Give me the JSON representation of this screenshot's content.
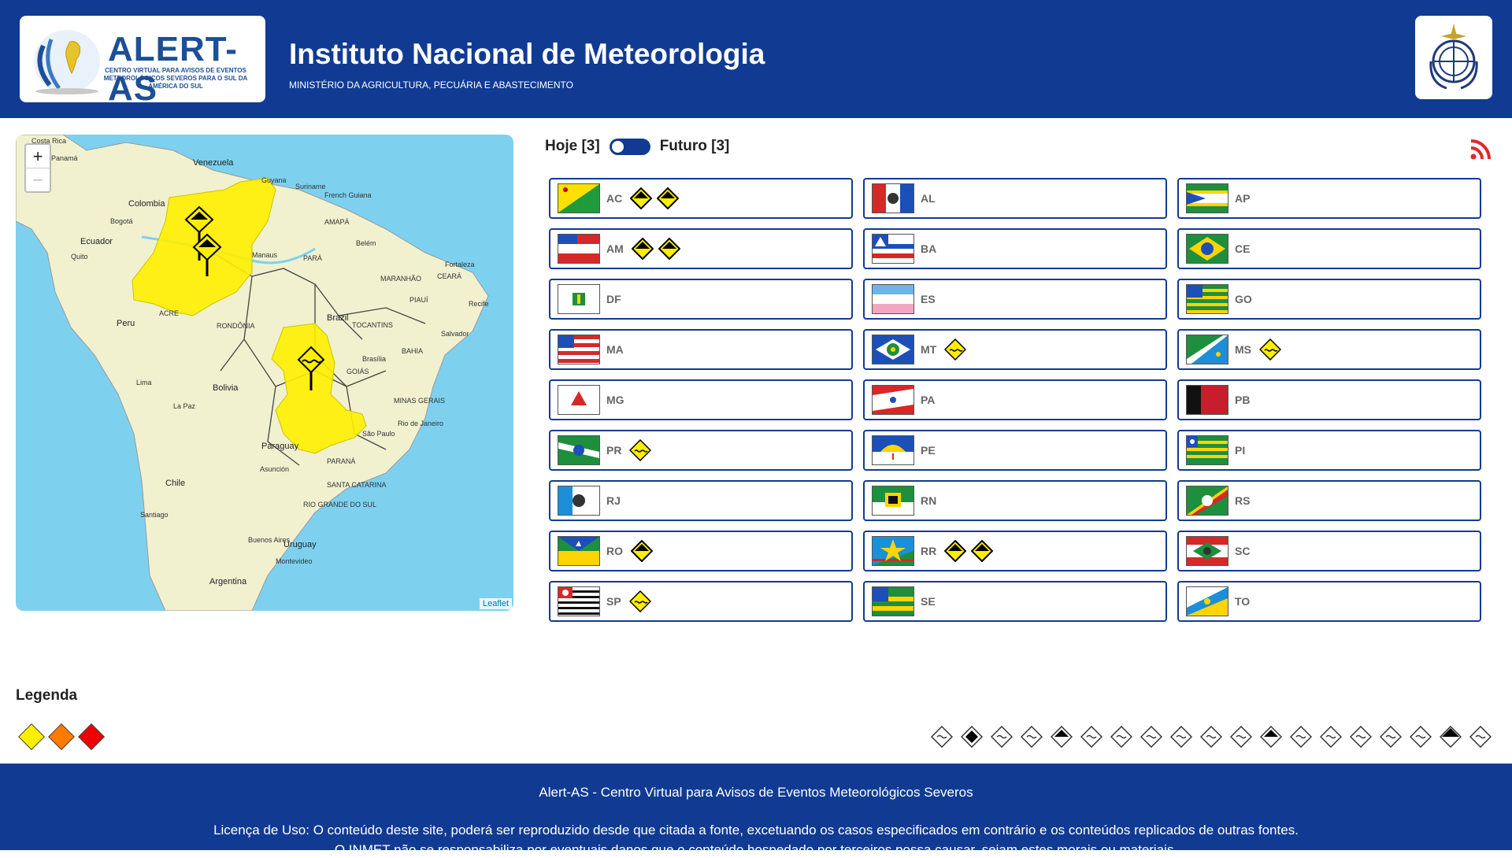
{
  "header": {
    "logo_text": "ALERT-AS",
    "logo_sub1": "CENTRO VIRTUAL PARA AVISOS DE EVENTOS",
    "logo_sub2": "METEOROLÓGICOS SEVEROS PARA O SUL DA AMÉRICA DO SUL",
    "title": "Instituto Nacional de Meteorologia",
    "subtitle": "MINISTÉRIO DA AGRICULTURA, PECUÁRIA E ABASTECIMENTO"
  },
  "map": {
    "zoom_in": "+",
    "zoom_out": "−",
    "attribution": "Leaflet",
    "labels": {
      "costa_rica": "Costa Rica",
      "panama": "Panamá",
      "venezuela": "Venezuela",
      "guyana": "Guyana",
      "suriname": "Suriname",
      "guiana": "French Guiana",
      "colombia": "Colombia",
      "ecuador": "Ecuador",
      "peru": "Peru",
      "brazil": "Brazil",
      "bolivia": "Bolivia",
      "paraguay": "Paraguay",
      "chile": "Chile",
      "uruguay": "Uruguay",
      "argentina": "Argentina",
      "amapa": "AMAPÁ",
      "para": "PARÁ",
      "maranhao": "MARANHÃO",
      "ceara": "CEARÁ",
      "piaui": "PIAUÍ",
      "tocantins": "TOCANTINS",
      "bahia": "BAHIA",
      "goias": "GOIÁS",
      "minas": "MINAS GERAIS",
      "rondonia": "RONDÔNIA",
      "acre": "ACRE",
      "parana": "PARANÁ",
      "sc": "SANTA CATARINA",
      "rs": "RIO GRANDE DO SUL",
      "lima": "Lima",
      "brasilia": "Brasília",
      "salvador": "Salvador",
      "santiago": "Santiago",
      "buenos_aires": "Buenos Aires",
      "montevideo": "Montevideo",
      "sao_paulo": "São Paulo",
      "rio": "Rio de Janeiro",
      "manaus": "Manaus",
      "belem": "Belém",
      "fortaleza": "Fortaleza",
      "recife": "Recife",
      "la_paz": "La Paz",
      "asuncion": "Asunción",
      "bogota": "Bogotá",
      "quito": "Quito"
    }
  },
  "toggle": {
    "today": "Hoje [3]",
    "future": "Futuro [3]"
  },
  "states": [
    {
      "code": "AC",
      "alerts": [
        "inverted-diamond",
        "inverted-diamond"
      ]
    },
    {
      "code": "AL",
      "alerts": []
    },
    {
      "code": "AP",
      "alerts": []
    },
    {
      "code": "AM",
      "alerts": [
        "inverted-diamond",
        "inverted-diamond"
      ]
    },
    {
      "code": "BA",
      "alerts": []
    },
    {
      "code": "CE",
      "alerts": []
    },
    {
      "code": "DF",
      "alerts": []
    },
    {
      "code": "ES",
      "alerts": []
    },
    {
      "code": "GO",
      "alerts": []
    },
    {
      "code": "MA",
      "alerts": []
    },
    {
      "code": "MT",
      "alerts": [
        "yellow-diamond"
      ]
    },
    {
      "code": "MS",
      "alerts": [
        "yellow-diamond"
      ]
    },
    {
      "code": "MG",
      "alerts": []
    },
    {
      "code": "PA",
      "alerts": []
    },
    {
      "code": "PB",
      "alerts": []
    },
    {
      "code": "PR",
      "alerts": [
        "yellow-diamond"
      ]
    },
    {
      "code": "PE",
      "alerts": []
    },
    {
      "code": "PI",
      "alerts": []
    },
    {
      "code": "RJ",
      "alerts": []
    },
    {
      "code": "RN",
      "alerts": []
    },
    {
      "code": "RS",
      "alerts": []
    },
    {
      "code": "RO",
      "alerts": [
        "inverted-diamond"
      ]
    },
    {
      "code": "RR",
      "alerts": [
        "inverted-diamond",
        "inverted-diamond"
      ]
    },
    {
      "code": "SC",
      "alerts": []
    },
    {
      "code": "SP",
      "alerts": [
        "yellow-diamond"
      ]
    },
    {
      "code": "SE",
      "alerts": []
    },
    {
      "code": "TO",
      "alerts": []
    }
  ],
  "legend": {
    "title": "Legenda",
    "severity_colors": [
      "#ffee00",
      "#ff7a00",
      "#ee0000"
    ],
    "event_icons": [
      "wind-icon",
      "hail-icon",
      "frost-icon",
      "storm-icon",
      "severe-storm-icon",
      "snow-icon",
      "dust-icon",
      "rain-icon",
      "cold-icon",
      "fog-icon",
      "heat-icon",
      "humidity-icon",
      "flood-icon",
      "fire-icon",
      "thermometer-icon",
      "heavy-rain-icon",
      "lightning-icon",
      "black-diamond-icon",
      "wave-icon"
    ]
  },
  "colors": {
    "brand": "#113b93",
    "alert_yellow": "#ffee00",
    "map_water": "#7dd1ef",
    "map_land": "#f1f1d0"
  },
  "footer": {
    "line1": "Alert-AS - Centro Virtual para Avisos de Eventos Meteorológicos Severos",
    "line2": "Licença de Uso: O conteúdo deste site, poderá ser reproduzido desde que citada a fonte, excetuando os casos especificados em contrário e os conteúdos replicados de outras fontes.",
    "line3": "O INMET não se responsabiliza por eventuais danos que o conteúdo hospedado por terceiros possa causar, sejam estes morais ou materiais."
  }
}
